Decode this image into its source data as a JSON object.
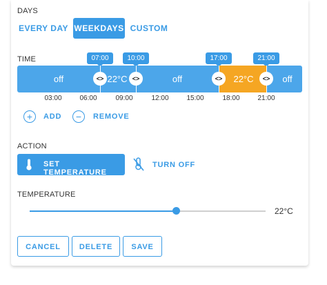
{
  "days": {
    "label": "DAYS",
    "options": [
      "EVERY DAY",
      "WEEKDAYS",
      "CUSTOM"
    ],
    "selected": "WEEKDAYS"
  },
  "time": {
    "label": "TIME",
    "segments": [
      {
        "label": "off"
      },
      {
        "label": "22°C"
      },
      {
        "label": "off"
      },
      {
        "label": "22°C"
      },
      {
        "label": "off"
      }
    ],
    "bubbles": [
      "07:00",
      "10:00",
      "17:00",
      "21:00"
    ],
    "ticks": [
      "03:00",
      "06:00",
      "09:00",
      "12:00",
      "15:00",
      "18:00",
      "21:00"
    ],
    "handle_glyph": "<>"
  },
  "actions_row": {
    "add_label": "ADD",
    "remove_label": "REMOVE"
  },
  "action": {
    "label": "ACTION",
    "set_temperature_label": "SET TEMPERATURE",
    "turn_off_label": "TURN OFF"
  },
  "temperature": {
    "label": "TEMPERATURE",
    "value": "22°C",
    "level": 0.62
  },
  "footer": {
    "cancel_label": "CANCEL",
    "delete_label": "DELETE",
    "save_label": "SAVE"
  },
  "colors": {
    "accent": "#3a9be5",
    "timeline": "#4ca6ea",
    "highlight": "#f5a623"
  }
}
